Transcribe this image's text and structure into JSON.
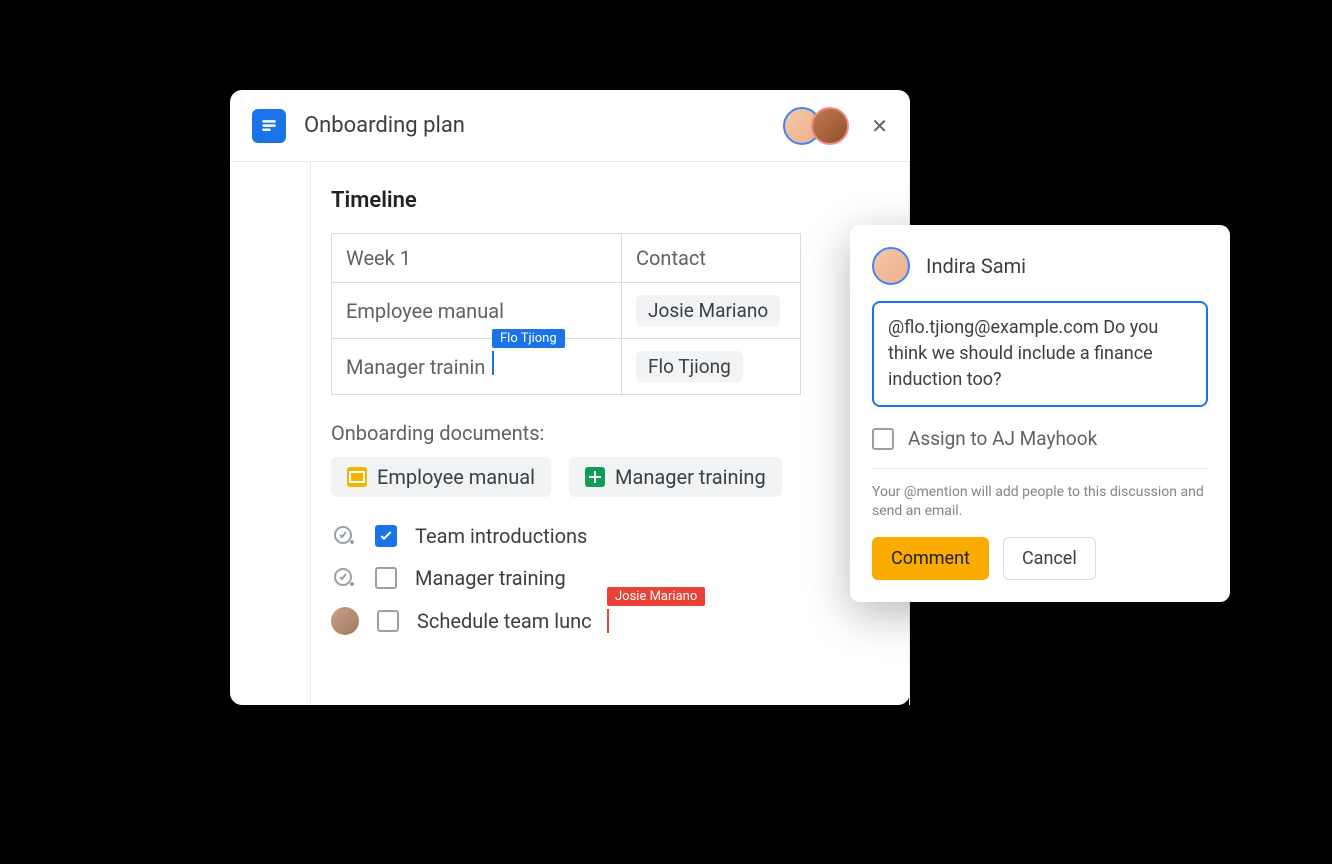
{
  "doc": {
    "title": "Onboarding plan",
    "section_title": "Timeline",
    "table": {
      "header_left": "Week 1",
      "header_right": "Contact",
      "rows": [
        {
          "left": "Employee manual",
          "right_chip": "Josie Mariano"
        },
        {
          "left": "Manager trainin",
          "right_chip": "Flo Tjiong"
        }
      ]
    },
    "cursor_blue_tag": "Flo Tjiong",
    "cursor_red_tag": "Josie Mariano",
    "subhead": "Onboarding documents:",
    "links": [
      {
        "icon": "slides",
        "label": "Employee manual"
      },
      {
        "icon": "sheets",
        "label": "Manager training"
      }
    ],
    "tasks": [
      {
        "checked": true,
        "label": "Team introductions",
        "lead": "assign"
      },
      {
        "checked": false,
        "label": "Manager training",
        "lead": "assign"
      },
      {
        "checked": false,
        "label": "Schedule team lunc",
        "lead": "avatar"
      }
    ]
  },
  "comment": {
    "author": "Indira Sami",
    "body": "@flo.tjiong@example.com Do you think we should include a finance induction too?",
    "assign_label": "Assign to AJ Mayhook",
    "hint": "Your @mention will add people to this discussion and send an email.",
    "primary": "Comment",
    "secondary": "Cancel"
  }
}
